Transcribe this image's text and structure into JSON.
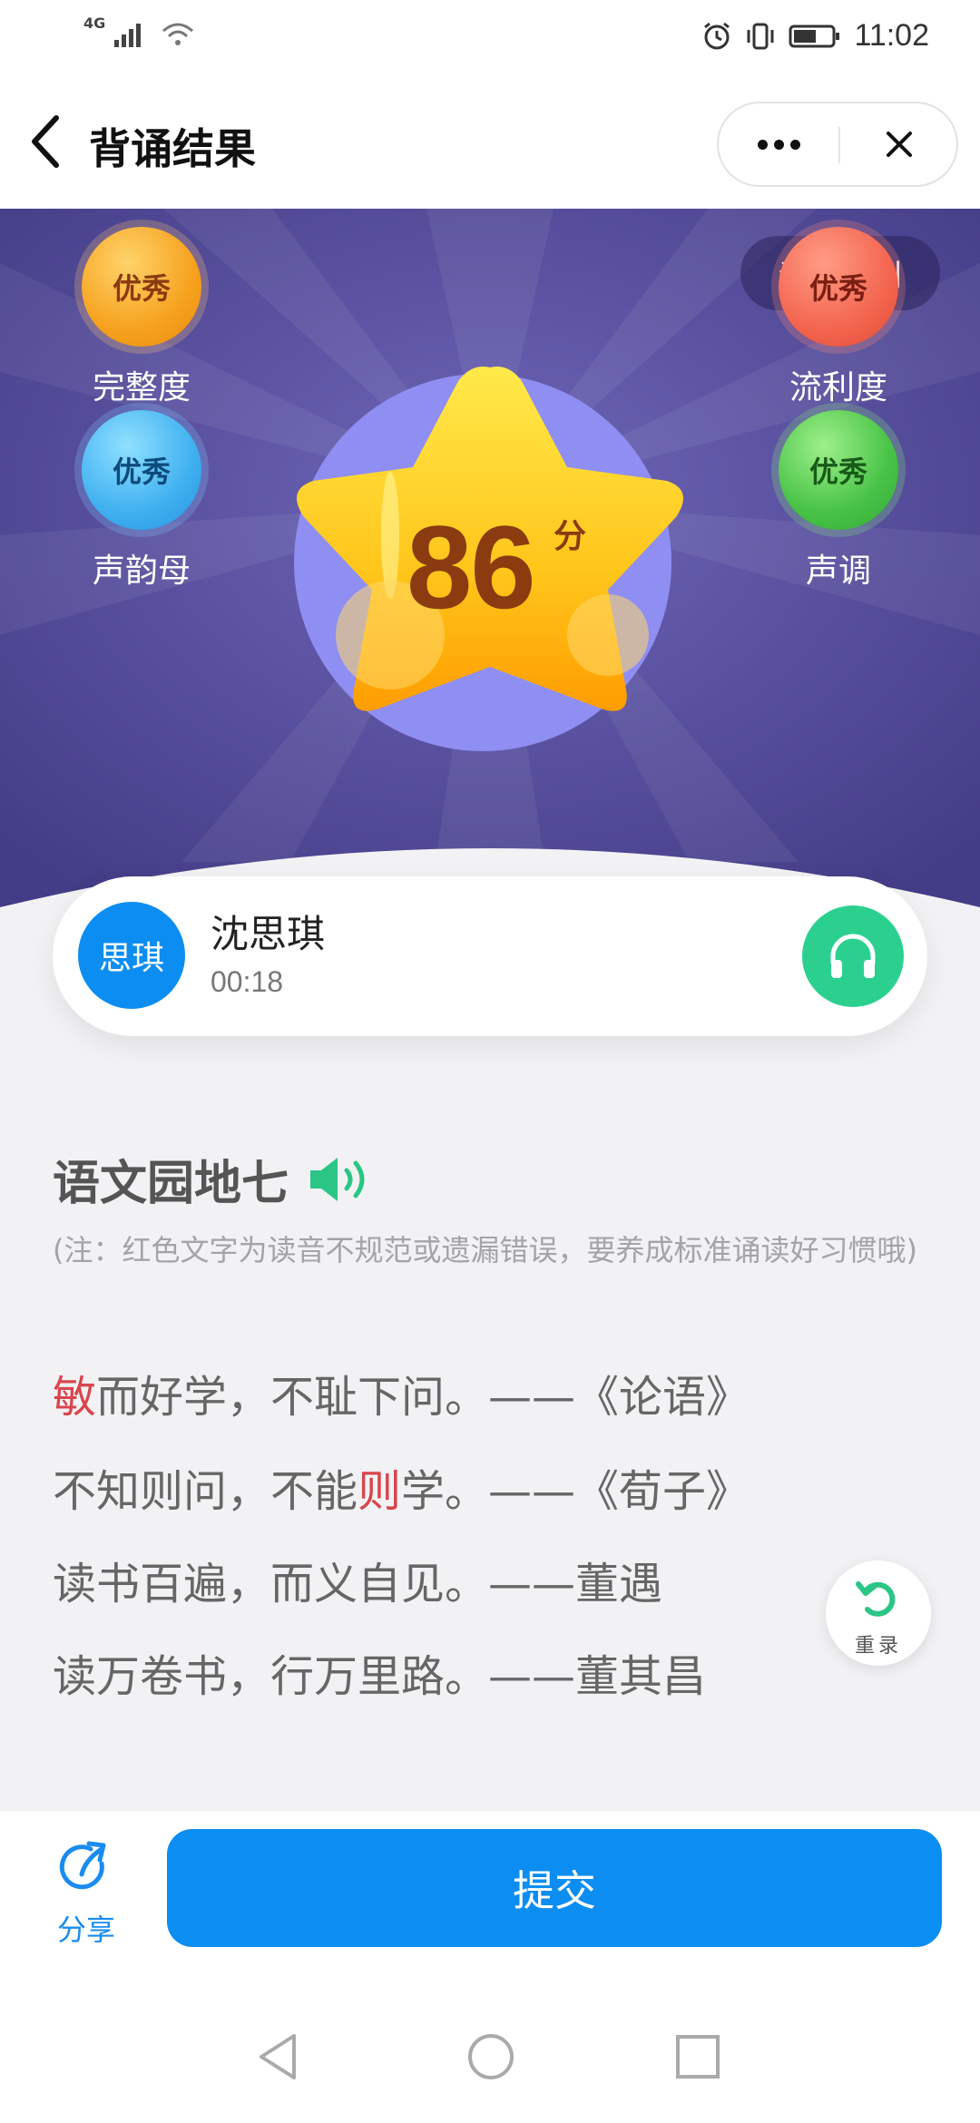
{
  "status_bar": {
    "network": "4G",
    "time": "11:02"
  },
  "header": {
    "title": "背诵结果"
  },
  "hero": {
    "rule_label": "评分规则",
    "score": "86",
    "score_unit": "分",
    "metrics": [
      {
        "label": "完整度",
        "grade": "优秀"
      },
      {
        "label": "流利度",
        "grade": "优秀"
      },
      {
        "label": "声韵母",
        "grade": "优秀"
      },
      {
        "label": "声调",
        "grade": "优秀"
      }
    ]
  },
  "user": {
    "avatar_text": "思琪",
    "name": "沈思琪",
    "duration": "00:18"
  },
  "content": {
    "title": "语文园地七",
    "note": "(注：红色文字为读音不规范或遗漏错误，要养成标准诵读好习惯哦)",
    "lines": [
      {
        "pre": "",
        "err": "敏",
        "post": "而好学，不耻下问。——《论语》"
      },
      {
        "pre": "不知则问，不能",
        "err": "则",
        "post": "学。——《荀子》"
      },
      {
        "pre": "读书百遍，而义自见。——董遇",
        "err": "",
        "post": ""
      },
      {
        "pre": "读万卷书，行万里路。——董其昌",
        "err": "",
        "post": ""
      }
    ]
  },
  "retry_label": "重录",
  "footer": {
    "share_label": "分享",
    "submit_label": "提交"
  },
  "colors": {
    "primary": "#0b8df2",
    "error": "#d9464d",
    "hero_bg": "#4b4590",
    "listen": "#2bd08f"
  }
}
